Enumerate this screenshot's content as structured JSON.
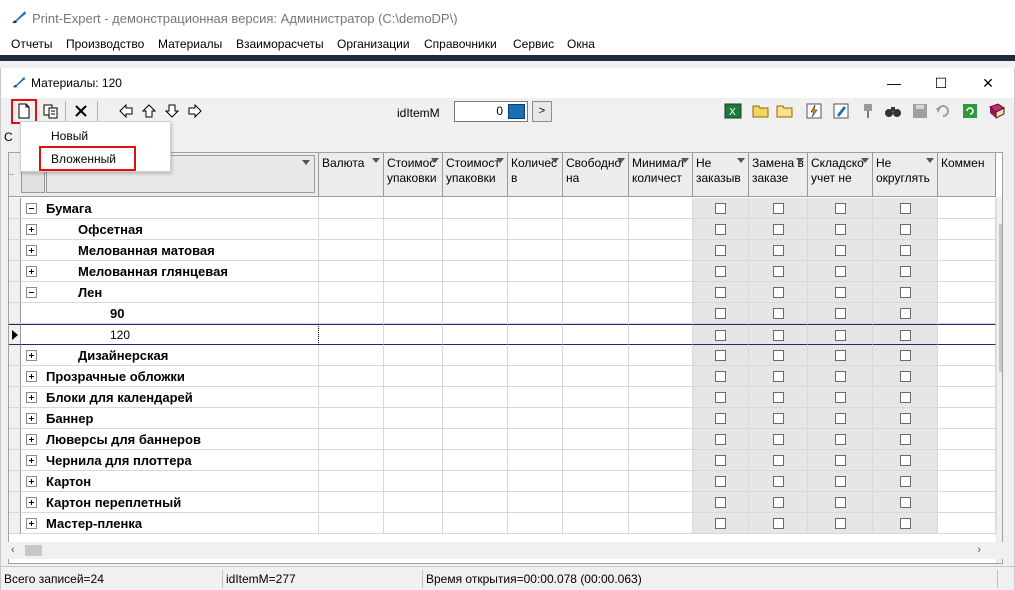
{
  "app": {
    "title": "Print-Expert - демонстрационная версия: Администратор (C:\\demoDP\\)",
    "menu": [
      "Отчеты",
      "Производство",
      "Материалы",
      "Взаиморасчеты",
      "Организации",
      "Справочники",
      "Сервис",
      "Окна"
    ]
  },
  "window": {
    "title": "Материалы: 120",
    "minimize": "—",
    "maximize": "☐",
    "close": "✕"
  },
  "toolbar": {
    "id_label": "idItemM",
    "id_value": "0",
    "go_label": ">",
    "icons": [
      "new-document-icon",
      "copy-icon",
      "delete-icon",
      "arrow-left-icon",
      "arrow-up-icon",
      "arrow-down-icon",
      "arrow-right-icon",
      "excel-icon",
      "folder-open-icon",
      "folder-icon",
      "filter-icon",
      "edit-icon",
      "pin-icon",
      "binoculars-icon",
      "save-icon",
      "undo-icon",
      "refresh-icon",
      "book-icon"
    ]
  },
  "popup": {
    "items": [
      "Новый",
      "Вложенный"
    ]
  },
  "grid": {
    "left_label": "С",
    "columns": [
      {
        "label": "Валюта"
      },
      {
        "label": "Стоимос упаковки"
      },
      {
        "label": "Стоимост упаковки"
      },
      {
        "label": "Количес в"
      },
      {
        "label": "Свободно на"
      },
      {
        "label": "Минимал количест"
      },
      {
        "label": "Не заказыв"
      },
      {
        "label": "Замена в заказе"
      },
      {
        "label": "Складско учет не"
      },
      {
        "label": "Не округлять"
      },
      {
        "label": "Коммен"
      }
    ],
    "rows": [
      {
        "name": "Бумага",
        "level": 0,
        "toggle": "minus",
        "bold": true
      },
      {
        "name": "Офсетная",
        "level": 1,
        "toggle": "plus",
        "bold": true
      },
      {
        "name": "Мелованная матовая",
        "level": 1,
        "toggle": "plus",
        "bold": true
      },
      {
        "name": "Мелованная глянцевая",
        "level": 1,
        "toggle": "plus",
        "bold": true
      },
      {
        "name": "Лен",
        "level": 1,
        "toggle": "minus",
        "bold": true
      },
      {
        "name": "90",
        "level": 2,
        "toggle": "none",
        "bold": true
      },
      {
        "name": "120",
        "level": 2,
        "toggle": "none",
        "bold": false,
        "selected": true
      },
      {
        "name": "Дизайнерская",
        "level": 1,
        "toggle": "plus",
        "bold": true
      },
      {
        "name": "Прозрачные обложки",
        "level": 0,
        "toggle": "plus",
        "bold": true
      },
      {
        "name": "Блоки для календарей",
        "level": 0,
        "toggle": "plus",
        "bold": true
      },
      {
        "name": "Баннер",
        "level": 0,
        "toggle": "plus",
        "bold": true
      },
      {
        "name": "Люверсы для баннеров",
        "level": 0,
        "toggle": "plus",
        "bold": true
      },
      {
        "name": "Чернила для плоттера",
        "level": 0,
        "toggle": "plus",
        "bold": true
      },
      {
        "name": "Картон",
        "level": 0,
        "toggle": "plus",
        "bold": true
      },
      {
        "name": "Картон переплетный",
        "level": 0,
        "toggle": "plus",
        "bold": true
      },
      {
        "name": "Мастер-пленка",
        "level": 0,
        "toggle": "plus",
        "bold": true
      }
    ]
  },
  "status": {
    "records": "Всего записей=24",
    "id": "idItemM=277",
    "time": "Время открытия=00:00.078 (00:00.063)"
  },
  "colors": {
    "accent_highlight": "#e01010",
    "selection_border": "#1a2a7a",
    "app_strip": "#1e2b3c"
  }
}
